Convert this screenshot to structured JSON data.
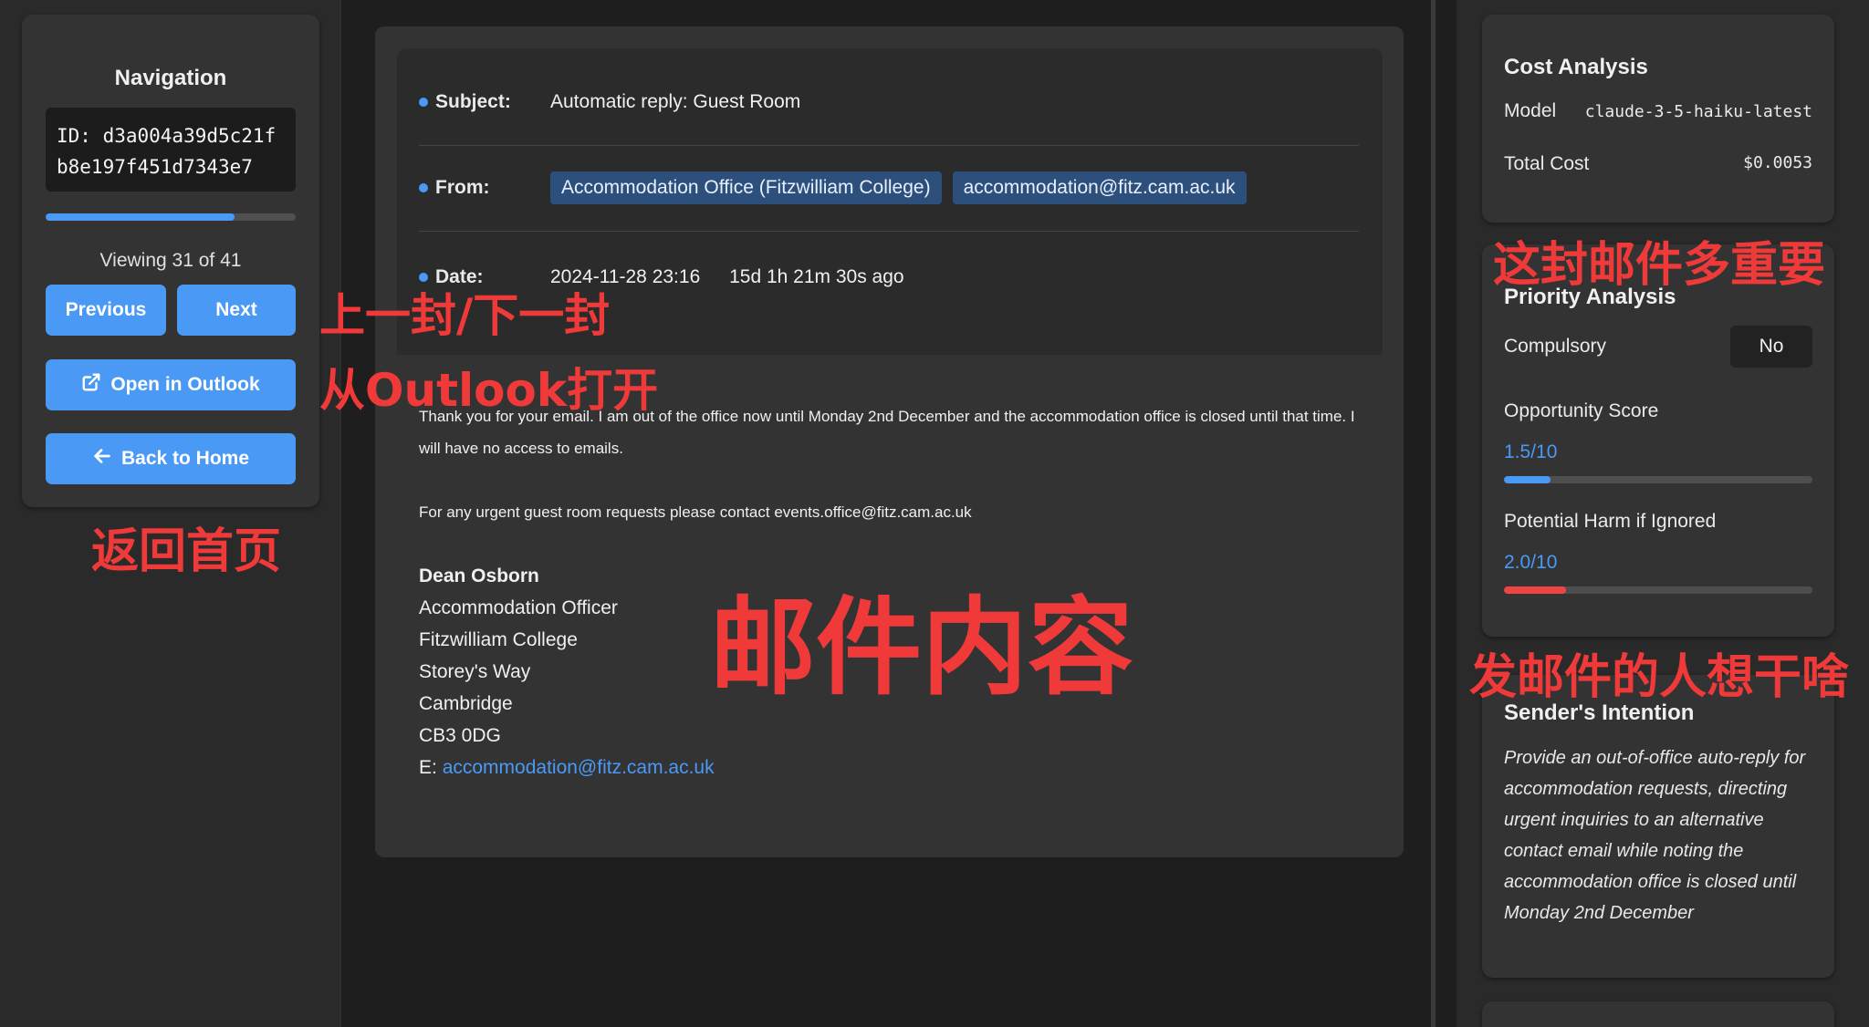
{
  "navigation": {
    "title": "Navigation",
    "id_text": "ID: d3a004a39d5c21fb8e197f451d7343e7",
    "progress_fraction": 0.756,
    "viewing_text": "Viewing 31 of 41",
    "previous_label": "Previous",
    "next_label": "Next",
    "outlook_label": "Open in Outlook",
    "home_label": "Back to Home"
  },
  "email": {
    "subject_label": "Subject:",
    "subject": "Automatic reply: Guest Room",
    "from_label": "From:",
    "from_name": "Accommodation Office (Fitzwilliam College)",
    "from_email": "accommodation@fitz.cam.ac.uk",
    "date_label": "Date:",
    "date": "2024-11-28 23:16",
    "age": "15d 1h 21m 30s ago",
    "body_para1": "Thank you for your email. I am out of the office now until Monday 2nd December and the accommodation office is closed until that time. I will have no access to emails.",
    "body_para2": "For any urgent guest room requests please contact events.office@fitz.cam.ac.uk",
    "signature": {
      "name": "Dean Osborn",
      "title": "Accommodation Officer",
      "college": "Fitzwilliam College",
      "street": "Storey's Way",
      "city": "Cambridge",
      "postcode": "CB3 0DG",
      "email_prefix": "E: ",
      "email": "accommodation@fitz.cam.ac.uk"
    }
  },
  "cost": {
    "title": "Cost Analysis",
    "model_label": "Model",
    "model": "claude-3-5-haiku-latest",
    "total_label": "Total Cost",
    "total": "$0.0053"
  },
  "priority": {
    "title": "Priority Analysis",
    "compulsory_label": "Compulsory",
    "compulsory_value": "No",
    "opportunity_label": "Opportunity Score",
    "opportunity_score": "1.5/10",
    "opportunity_fraction": 0.15,
    "harm_label": "Potential Harm if Ignored",
    "harm_score": "2.0/10",
    "harm_fraction": 0.2
  },
  "intention": {
    "title": "Sender's Intention",
    "text": "Provide an out-of-office auto-reply for accommodation requests, directing urgent inquiries to an alternative contact email while noting the accommodation office is closed until Monday 2nd December"
  },
  "colors": {
    "accent": "#4a9af5",
    "harm": "#ef4444",
    "annotation": "#f03a3a"
  },
  "annotations": {
    "prev_next": "上一封/下一封",
    "outlook": "从Outlook打开",
    "home": "返回首页",
    "content": "邮件内容",
    "importance": "这封邮件多重要",
    "intent": "发邮件的人想干啥"
  }
}
